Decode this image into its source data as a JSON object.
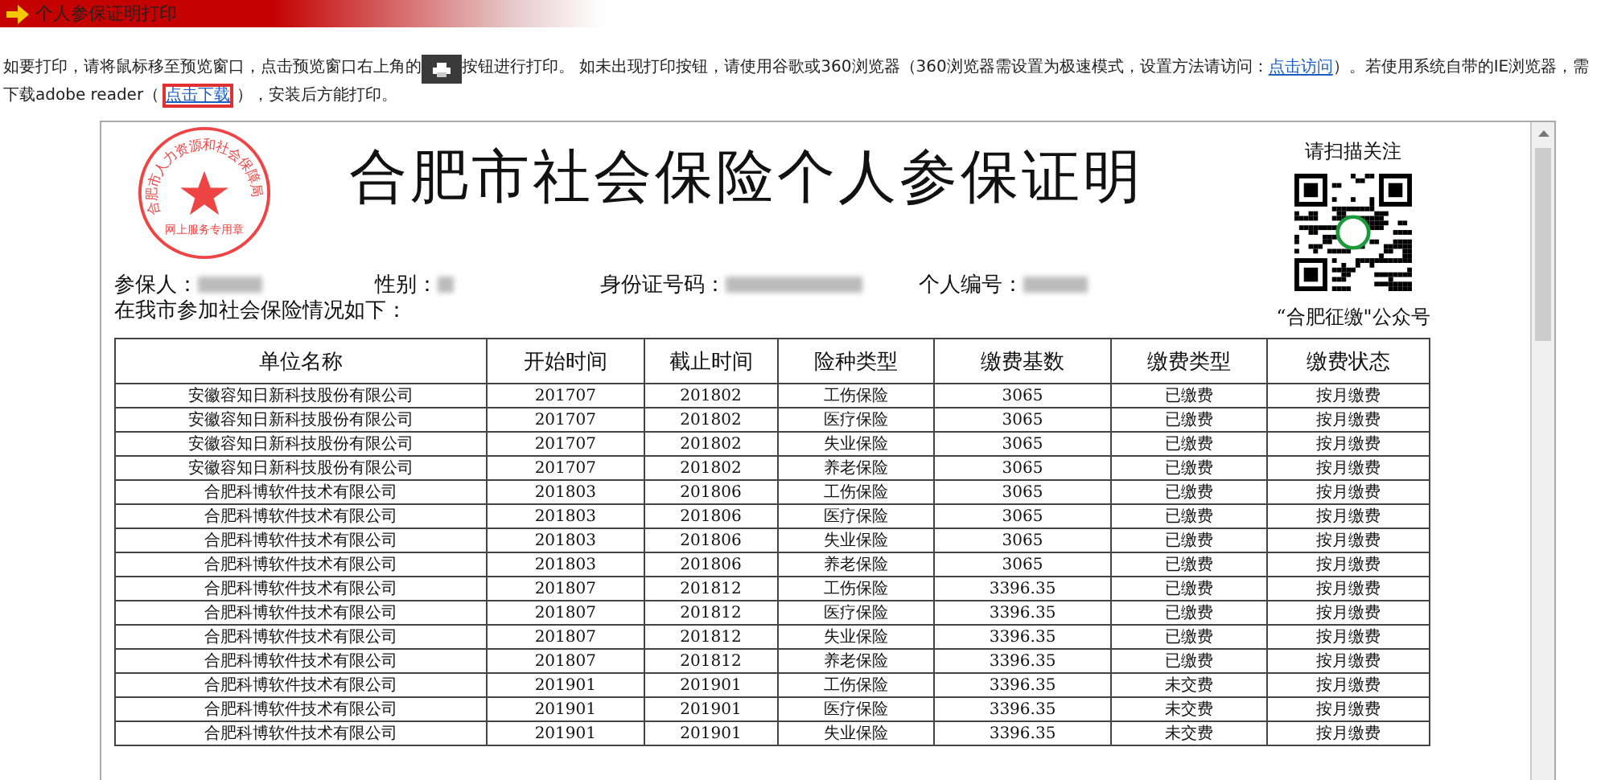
{
  "header": {
    "title": "个人参保证明打印"
  },
  "instructions": [
    {
      "kind": "text",
      "text": "如要打印，请将鼠标移至预览窗口，点击预览窗口右上角的"
    },
    {
      "kind": "print_button"
    },
    {
      "kind": "text",
      "text": "按钮进行打印。 如未出现打印按钮，请使用谷歌或360浏览器（360浏览器需设置为极速模式，设置方法请访问："
    },
    {
      "kind": "link",
      "text": "点击访问"
    },
    {
      "kind": "text",
      "text": "）。若使用系统自带的IE浏览器，需下载adobe reader（"
    },
    {
      "kind": "link",
      "text": "点击下载",
      "highlighted": true
    },
    {
      "kind": "text",
      "text": "），安装后方能打印。"
    }
  ],
  "document": {
    "seal": {
      "outer_text": "合肥市人力资源和社会保障局",
      "inner_text": "网上服务专用章"
    },
    "title": "合肥市社会保险个人参保证明",
    "qr": {
      "caption_top": "请扫描关注",
      "caption_bottom": "“合肥征缴\"公众号"
    },
    "fields": [
      {
        "label": "参保人："
      },
      {
        "label": "性别："
      },
      {
        "label": "身份证号码："
      },
      {
        "label": "个人编号："
      }
    ],
    "intro": "在我市参加社会保险情况如下：",
    "table": {
      "columns": [
        "单位名称",
        "开始时间",
        "截止时间",
        "险种类型",
        "缴费基数",
        "缴费类型",
        "缴费状态"
      ],
      "rows": [
        [
          "安徽容知日新科技股份有限公司",
          "201707",
          "201802",
          "工伤保险",
          "3065",
          "已缴费",
          "按月缴费"
        ],
        [
          "安徽容知日新科技股份有限公司",
          "201707",
          "201802",
          "医疗保险",
          "3065",
          "已缴费",
          "按月缴费"
        ],
        [
          "安徽容知日新科技股份有限公司",
          "201707",
          "201802",
          "失业保险",
          "3065",
          "已缴费",
          "按月缴费"
        ],
        [
          "安徽容知日新科技股份有限公司",
          "201707",
          "201802",
          "养老保险",
          "3065",
          "已缴费",
          "按月缴费"
        ],
        [
          "合肥科博软件技术有限公司",
          "201803",
          "201806",
          "工伤保险",
          "3065",
          "已缴费",
          "按月缴费"
        ],
        [
          "合肥科博软件技术有限公司",
          "201803",
          "201806",
          "医疗保险",
          "3065",
          "已缴费",
          "按月缴费"
        ],
        [
          "合肥科博软件技术有限公司",
          "201803",
          "201806",
          "失业保险",
          "3065",
          "已缴费",
          "按月缴费"
        ],
        [
          "合肥科博软件技术有限公司",
          "201803",
          "201806",
          "养老保险",
          "3065",
          "已缴费",
          "按月缴费"
        ],
        [
          "合肥科博软件技术有限公司",
          "201807",
          "201812",
          "工伤保险",
          "3396.35",
          "已缴费",
          "按月缴费"
        ],
        [
          "合肥科博软件技术有限公司",
          "201807",
          "201812",
          "医疗保险",
          "3396.35",
          "已缴费",
          "按月缴费"
        ],
        [
          "合肥科博软件技术有限公司",
          "201807",
          "201812",
          "失业保险",
          "3396.35",
          "已缴费",
          "按月缴费"
        ],
        [
          "合肥科博软件技术有限公司",
          "201807",
          "201812",
          "养老保险",
          "3396.35",
          "已缴费",
          "按月缴费"
        ],
        [
          "合肥科博软件技术有限公司",
          "201901",
          "201901",
          "工伤保险",
          "3396.35",
          "未交费",
          "按月缴费"
        ],
        [
          "合肥科博软件技术有限公司",
          "201901",
          "201901",
          "医疗保险",
          "3396.35",
          "未交费",
          "按月缴费"
        ],
        [
          "合肥科博软件技术有限公司",
          "201901",
          "201901",
          "失业保险",
          "3396.35",
          "未交费",
          "按月缴费"
        ]
      ]
    }
  }
}
